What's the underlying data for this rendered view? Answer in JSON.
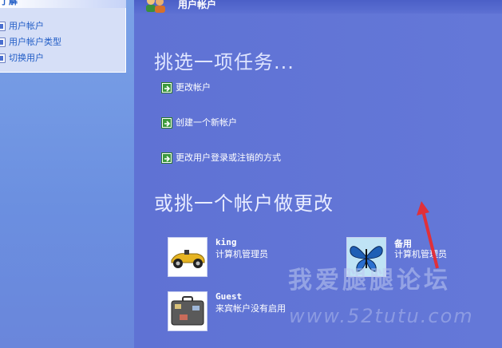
{
  "left_pane": {
    "learn_header": "了解",
    "learn_items": [
      "用户帐户",
      "用户帐户类型",
      "切换用户"
    ]
  },
  "window": {
    "title": "用户帐户"
  },
  "tasks": {
    "heading": "挑选一项任务...",
    "items": [
      "更改帐户",
      "创建一个新帐户",
      "更改用户登录或注销的方式"
    ]
  },
  "accounts": {
    "heading": "或挑一个帐户做更改",
    "items": [
      {
        "name": "king",
        "role": "计算机管理员",
        "picture": "race-car-icon"
      },
      {
        "name": "备用",
        "role": "计算机管理员",
        "picture": "butterfly-icon"
      },
      {
        "name": "Guest",
        "role": "来宾帐户没有启用",
        "picture": "suitcase-icon"
      }
    ]
  },
  "watermark": {
    "text": "我爱腿腿论坛",
    "url": "www.52tutu.com"
  },
  "colors": {
    "main_bg": "#6375d6",
    "left_pane_bg": "#7ba2e7",
    "link_text": "#ffffff",
    "learn_link": "#215dc6",
    "arrow_green": "#3c9a3c",
    "annotation_red": "#e0303a"
  }
}
